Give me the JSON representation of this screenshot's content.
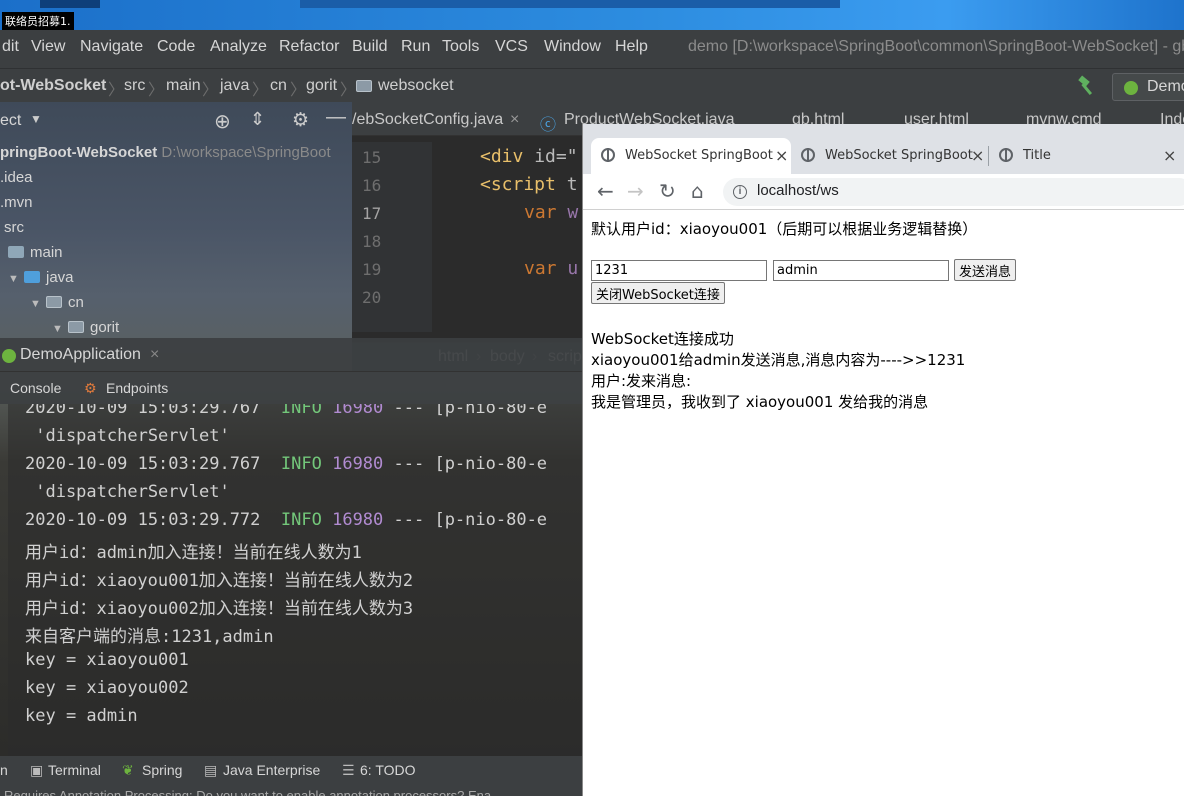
{
  "desktop": {
    "label": "联络员招募1."
  },
  "ide": {
    "menu": [
      "dit",
      "View",
      "Navigate",
      "Code",
      "Analyze",
      "Refactor",
      "Build",
      "Run",
      "Tools",
      "VCS",
      "Window",
      "Help"
    ],
    "project_title": "demo [D:\\workspace\\SpringBoot\\common\\SpringBoot-WebSocket] - gb",
    "breadcrumbs": [
      "ot-WebSocket",
      "src",
      "main",
      "java",
      "cn",
      "gorit",
      "websocket"
    ],
    "run_config": "Demo",
    "project_panel": {
      "header": "ect",
      "root": "pringBoot-WebSocket",
      "root_path": "D:\\workspace\\SpringBoot",
      "items": [
        ".idea",
        ".mvn",
        "src",
        "main",
        "java",
        "cn",
        "gorit"
      ]
    },
    "editor": {
      "tabs": [
        "/ebSocketConfig.java",
        "ProductWebSocket.java",
        "gb.html",
        "user.html",
        "mvnw.cmd",
        "Inde"
      ],
      "line_numbers": [
        "15",
        "16",
        "17",
        "18",
        "19",
        "20"
      ],
      "code": {
        "l15_tag": "<div",
        "l15_attr": " id=\"",
        "l16_tag": "<script",
        "l16_attr": " t",
        "l17_kw": "var",
        "l17_var": " w",
        "l19_kw": "var",
        "l19_var": " u"
      },
      "breadcrumb": [
        "html",
        "body",
        "scrip"
      ]
    },
    "run_window": {
      "tab": "DemoApplication",
      "sub_tabs": [
        "Console",
        "Endpoints"
      ]
    },
    "console": {
      "lines": [
        {
          "ts": "2020-10-09 15:03:29.767",
          "level": "INFO",
          "pid": "16980",
          "rest": " --- [p-nio-80-e"
        },
        {
          "text": " 'dispatcherServlet'"
        },
        {
          "ts": "2020-10-09 15:03:29.767",
          "level": "INFO",
          "pid": "16980",
          "rest": " --- [p-nio-80-e"
        },
        {
          "text": " 'dispatcherServlet'"
        },
        {
          "ts": "2020-10-09 15:03:29.772",
          "level": "INFO",
          "pid": "16980",
          "rest": " --- [p-nio-80-e"
        },
        {
          "text": "用户id：admin加入连接！当前在线人数为1"
        },
        {
          "text": "用户id：xiaoyou001加入连接！当前在线人数为2"
        },
        {
          "text": "用户id：xiaoyou002加入连接！当前在线人数为3"
        },
        {
          "text": "来自客户端的消息:1231,admin"
        },
        {
          "text": "key = xiaoyou001"
        },
        {
          "text": "key = xiaoyou002"
        },
        {
          "text": "key = admin"
        }
      ]
    },
    "bottom_tools": [
      "n",
      "Terminal",
      "Spring",
      "Java Enterprise",
      "6: TODO"
    ],
    "status": "Requires Annotation Processing: Do you want to enable annotation processors? Ena"
  },
  "browser": {
    "tabs": [
      {
        "title": "WebSocket SpringBoot",
        "active": true
      },
      {
        "title": "WebSocket SpringBoot",
        "active": false
      },
      {
        "title": "Title",
        "active": false
      }
    ],
    "url": "localhost/ws",
    "page": {
      "intro": "默认用户id：xiaoyou001（后期可以根据业务逻辑替换）",
      "message_input": "1231",
      "target_input": "admin",
      "send_button": "发送消息",
      "close_button": "关闭WebSocket连接",
      "messages": [
        "WebSocket连接成功",
        "xiaoyou001给admin发送消息,消息内容为---->>1231",
        "用户:发来消息:",
        "我是管理员，我收到了 xiaoyou001 发给我的消息"
      ]
    }
  },
  "colors": {
    "ide_bg": "#3c3f41",
    "info": "#73c77a",
    "pid": "#b18bd1"
  }
}
